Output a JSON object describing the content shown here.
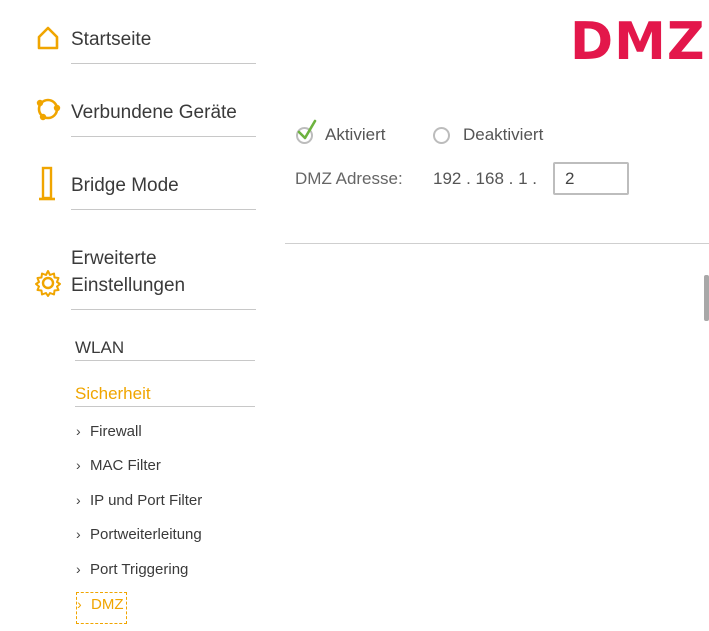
{
  "title": "DMZ",
  "brand_color": "#e3174b",
  "accent_color": "#f0a500",
  "sidebar": {
    "items": [
      {
        "label": "Startseite",
        "icon": "home-icon"
      },
      {
        "label": "Verbundene Geräte",
        "icon": "devices-icon"
      },
      {
        "label": "Bridge Mode",
        "icon": "bridge-icon"
      },
      {
        "label": "Erweiterte Einstellungen",
        "icon": "gear-icon"
      }
    ],
    "subsections": {
      "wlan": "WLAN",
      "security": "Sicherheit"
    },
    "security_links": [
      {
        "label": "Firewall"
      },
      {
        "label": "MAC Filter"
      },
      {
        "label": "IP und Port Filter"
      },
      {
        "label": "Portweiterleitung"
      },
      {
        "label": "Port Triggering"
      },
      {
        "label": "DMZ",
        "active": true
      }
    ],
    "chevron": "›"
  },
  "main": {
    "radio_enabled": {
      "label": "Aktiviert",
      "selected": true
    },
    "radio_disabled": {
      "label": "Deaktiviert",
      "selected": false
    },
    "address_label": "DMZ Adresse:",
    "ip_prefix": "192 . 168 . 1 .",
    "ip_last_octet": "2"
  }
}
